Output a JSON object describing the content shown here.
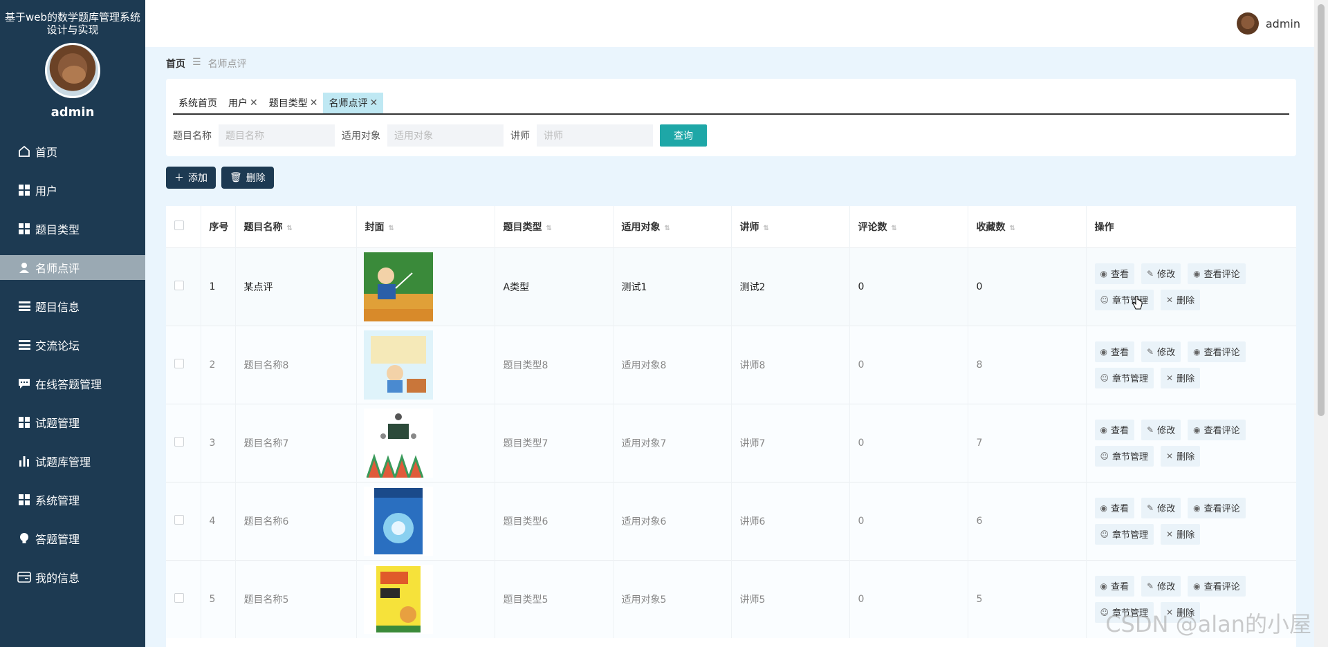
{
  "app": {
    "title": "基于web的数学题库管理系统设计与实现",
    "user": "admin"
  },
  "sidebar": {
    "items": [
      {
        "label": "首页",
        "icon": "home-icon"
      },
      {
        "label": "用户",
        "icon": "grid-icon"
      },
      {
        "label": "题目类型",
        "icon": "grid-icon"
      },
      {
        "label": "名师点评",
        "icon": "user-icon",
        "active": true
      },
      {
        "label": "题目信息",
        "icon": "list-icon"
      },
      {
        "label": "交流论坛",
        "icon": "list-icon"
      },
      {
        "label": "在线答题管理",
        "icon": "chat-icon"
      },
      {
        "label": "试题管理",
        "icon": "grid-icon"
      },
      {
        "label": "试题库管理",
        "icon": "bar-chart-icon"
      },
      {
        "label": "系统管理",
        "icon": "grid-icon"
      },
      {
        "label": "答题管理",
        "icon": "bulb-icon"
      },
      {
        "label": "我的信息",
        "icon": "card-icon"
      }
    ]
  },
  "topbar": {
    "user": "admin"
  },
  "breadcrumb": {
    "home": "首页",
    "separator": "☰",
    "current": "名师点评"
  },
  "tabs": [
    {
      "label": "系统首页",
      "closable": false
    },
    {
      "label": "用户",
      "closable": true
    },
    {
      "label": "题目类型",
      "closable": true
    },
    {
      "label": "名师点评",
      "closable": true,
      "active": true
    }
  ],
  "search": {
    "name_label": "题目名称",
    "name_placeholder": "题目名称",
    "target_label": "适用对象",
    "target_placeholder": "适用对象",
    "teacher_label": "讲师",
    "teacher_placeholder": "讲师",
    "button": "查询"
  },
  "toolbar": {
    "add": "添加",
    "delete": "删除"
  },
  "table": {
    "headers": [
      "序号",
      "题目名称",
      "封面",
      "题目类型",
      "适用对象",
      "讲师",
      "评论数",
      "收藏数",
      "操作"
    ],
    "ops": {
      "view": "查看",
      "edit": "修改",
      "view_comments": "查看评论",
      "chapters": "章节管理",
      "delete": "删除"
    },
    "rows": [
      {
        "no": "1",
        "name": "某点评",
        "type": "A类型",
        "target": "测试1",
        "teacher": "测试2",
        "comments": "0",
        "favorites": "0"
      },
      {
        "no": "2",
        "name": "题目名称8",
        "type": "题目类型8",
        "target": "适用对象8",
        "teacher": "讲师8",
        "comments": "0",
        "favorites": "8"
      },
      {
        "no": "3",
        "name": "题目名称7",
        "type": "题目类型7",
        "target": "适用对象7",
        "teacher": "讲师7",
        "comments": "0",
        "favorites": "7"
      },
      {
        "no": "4",
        "name": "题目名称6",
        "type": "题目类型6",
        "target": "适用对象6",
        "teacher": "讲师6",
        "comments": "0",
        "favorites": "6"
      },
      {
        "no": "5",
        "name": "题目名称5",
        "type": "题目类型5",
        "target": "适用对象5",
        "teacher": "讲师5",
        "comments": "0",
        "favorites": "5"
      }
    ]
  },
  "watermark": "CSDN @alan的小屋"
}
